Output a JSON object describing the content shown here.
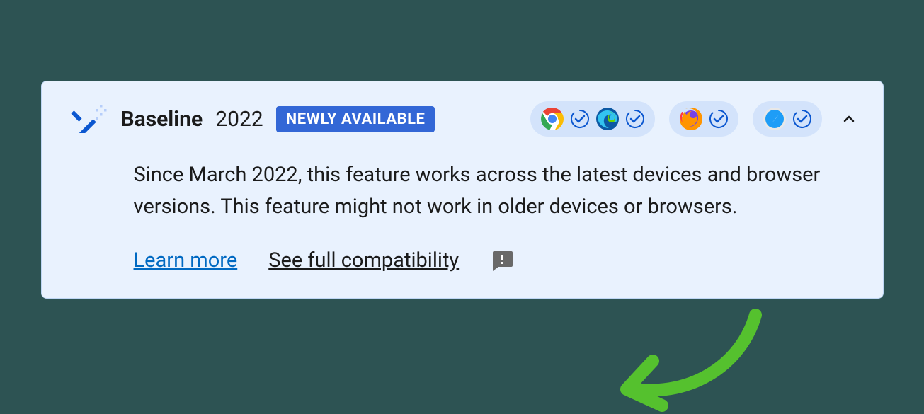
{
  "header": {
    "title_bold": "Baseline",
    "title_year": "2022",
    "badge": "NEWLY AVAILABLE"
  },
  "browsers": {
    "chrome": "chrome",
    "edge": "edge",
    "firefox": "firefox",
    "safari": "safari"
  },
  "description": "Since March 2022, this feature works across the latest devices and browser versions. This feature might not work in older devices or browsers.",
  "links": {
    "learn_more": "Learn more",
    "full_compat": "See full compatibility"
  },
  "colors": {
    "card_bg": "#e9f2fe",
    "badge_bg": "#3367d6",
    "link_blue": "#0069c2",
    "arrow_green": "#55c12e"
  }
}
